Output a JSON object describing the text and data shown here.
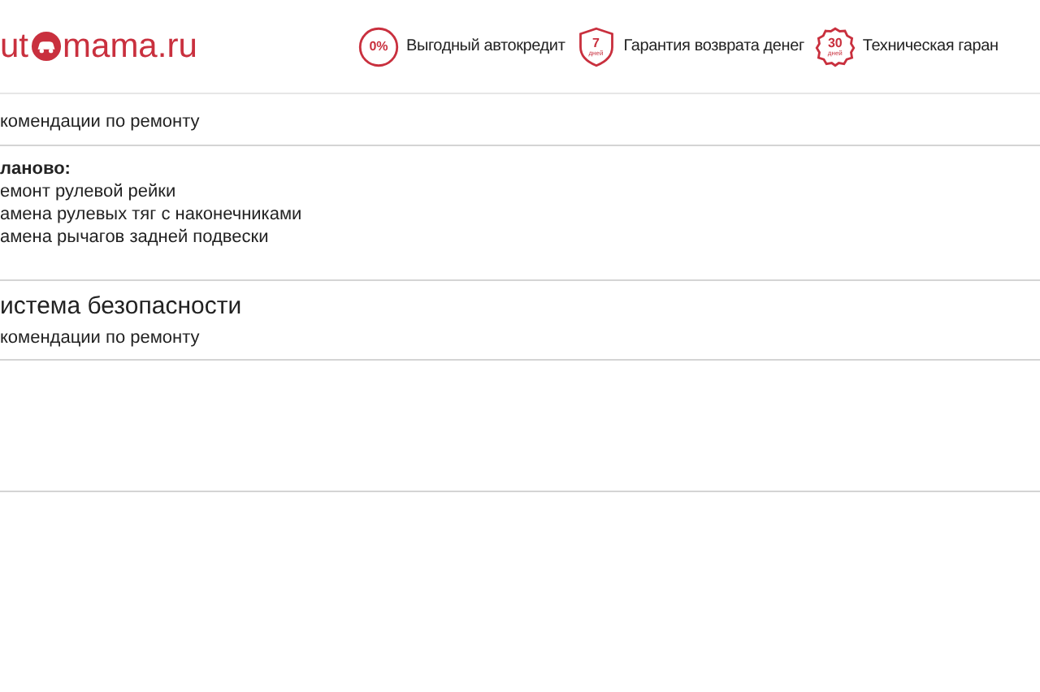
{
  "logo": {
    "left": "ut",
    "right": "mama.ru"
  },
  "benefits": [
    {
      "kind": "circle",
      "icon_text": "0%",
      "label": "Выгодный автокредит"
    },
    {
      "kind": "shield",
      "icon_text": "7",
      "icon_subtext": "дней",
      "label": "Гарантия возврата денег"
    },
    {
      "kind": "seal",
      "icon_text": "30",
      "icon_subtext": "дней",
      "label": "Техническая гаран"
    }
  ],
  "sections": [
    {
      "recommendations_label": "комендации по ремонту",
      "plan_heading": "ланово:",
      "items": [
        "емонт рулевой рейки",
        "амена рулевых тяг с наконечниками",
        "амена рычагов задней подвески"
      ]
    },
    {
      "title": "истема безопасности",
      "recommendations_label": "комендации по ремонту"
    }
  ]
}
